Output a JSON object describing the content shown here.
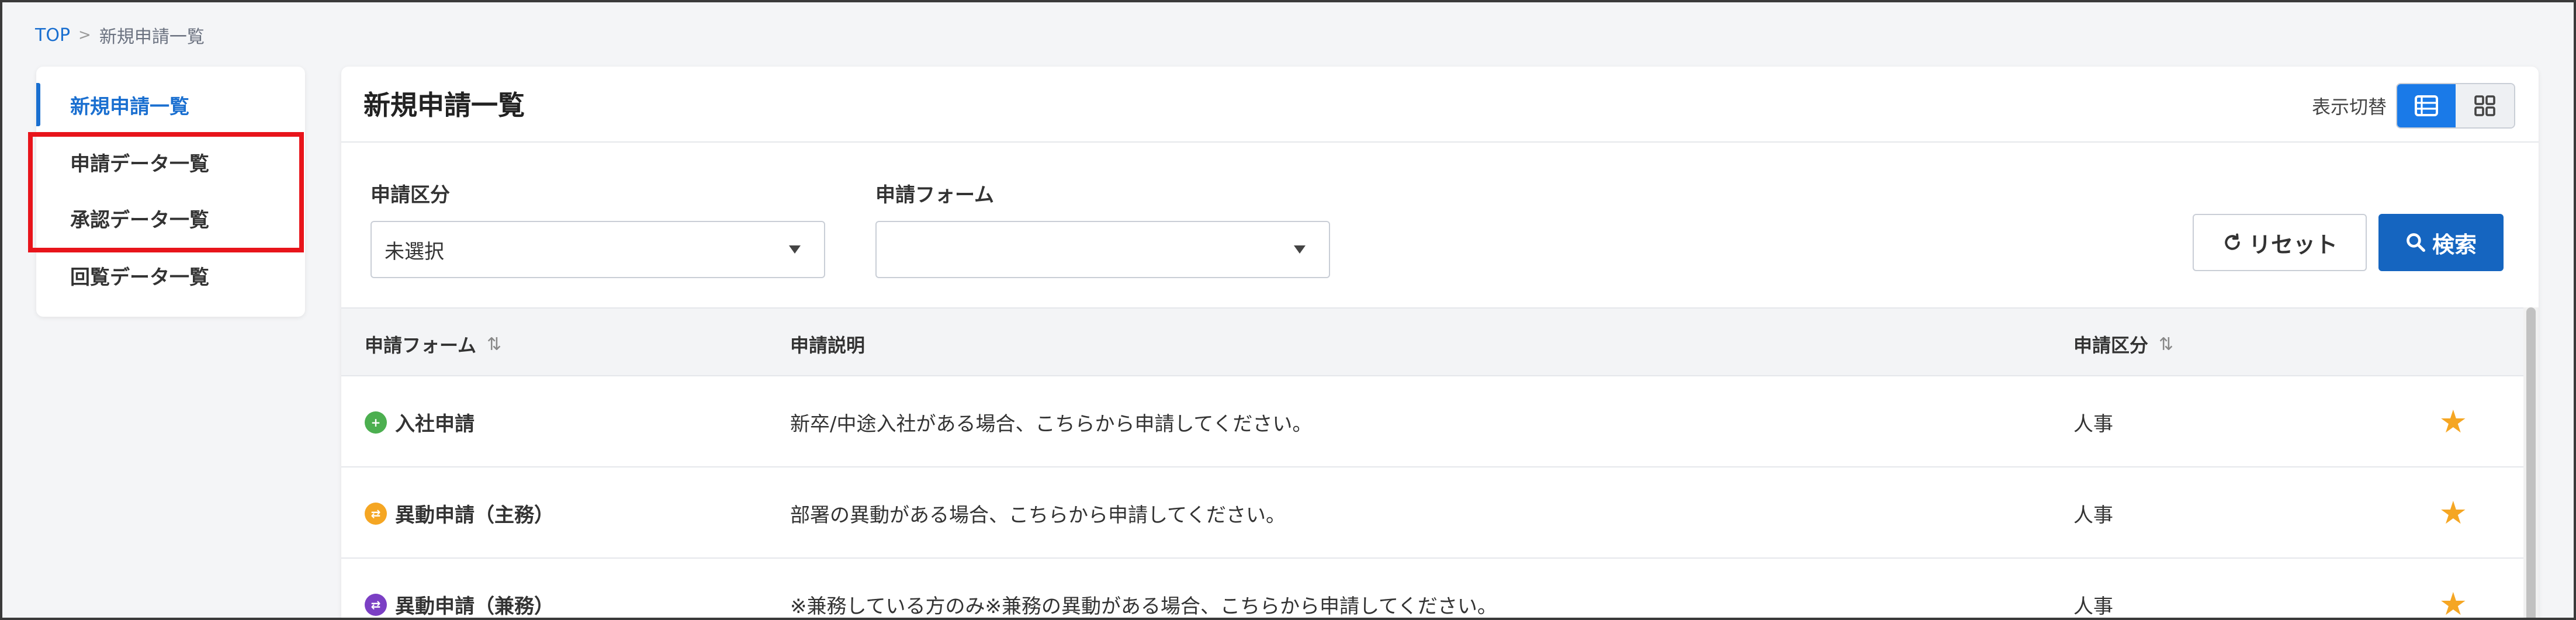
{
  "breadcrumb": {
    "home": "TOP",
    "separator": ">",
    "current": "新規申請一覧"
  },
  "sidebar": {
    "items": [
      {
        "label": "新規申請一覧",
        "active": true
      },
      {
        "label": "申請データ一覧",
        "active": false
      },
      {
        "label": "承認データ一覧",
        "active": false
      },
      {
        "label": "回覧データ一覧",
        "active": false
      }
    ]
  },
  "main": {
    "title": "新規申請一覧",
    "view_toggle_label": "表示切替",
    "filters": {
      "category": {
        "label": "申請区分",
        "value": "未選択"
      },
      "form": {
        "label": "申請フォーム",
        "value": ""
      }
    },
    "reset_label": "リセット",
    "search_label": "検索"
  },
  "table": {
    "headers": {
      "form": "申請フォーム",
      "description": "申請説明",
      "category": "申請区分"
    },
    "rows": [
      {
        "form": "入社申請",
        "description": "新卒/中途入社がある場合、こちらから申請してください。",
        "category": "人事",
        "icon": "user-plus-icon",
        "icon_color": "#4caf50"
      },
      {
        "form": "異動申請（主務）",
        "description": "部署の異動がある場合、こちらから申請してください。",
        "category": "人事",
        "icon": "transfer-icon",
        "icon_color": "#f5a623"
      },
      {
        "form": "異動申請（兼務）",
        "description": "※兼務している方のみ※兼務の異動がある場合、こちらから申請してください。",
        "category": "人事",
        "icon": "transfer-icon",
        "icon_color": "#7b3fc4"
      }
    ]
  },
  "colors": {
    "accent": "#1a6fd0",
    "primary_button": "#1565c0",
    "star": "#f5a623",
    "highlight": "#e8141b"
  }
}
